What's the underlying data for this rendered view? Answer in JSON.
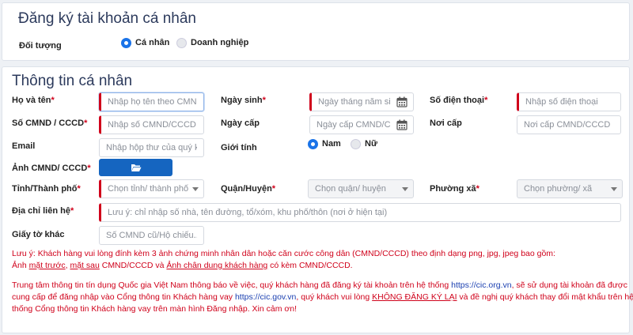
{
  "account_section": {
    "title": "Đăng ký tài khoản cá nhân",
    "type_label": "Đối tượng",
    "options": [
      {
        "label": "Cá nhân",
        "selected": true
      },
      {
        "label": "Doanh nghiệp",
        "selected": false
      }
    ]
  },
  "personal_section": {
    "title": "Thông tin cá nhân",
    "fields": {
      "full_name": {
        "label": "Họ và tên",
        "req": "*",
        "placeholder": "Nhập họ tên theo CMND"
      },
      "birth_date": {
        "label": "Ngày sinh",
        "req": "*",
        "placeholder": "Ngày tháng năm sinh"
      },
      "phone": {
        "label": "Số điện thoại",
        "req": "*",
        "placeholder": "Nhập số điện thoại"
      },
      "id_number": {
        "label": "Số CMND / CCCD",
        "req": "*",
        "placeholder": "Nhập số CMND/CCCD"
      },
      "issue_date": {
        "label": "Ngày cấp",
        "placeholder": "Ngày cấp CMND/CCCD"
      },
      "issue_place": {
        "label": "Nơi cấp",
        "placeholder": "Nơi cấp CMND/CCCD"
      },
      "email": {
        "label": "Email",
        "placeholder": "Nhập hộp thư của quý khách"
      },
      "gender": {
        "label": "Giới tính",
        "options": [
          {
            "label": "Nam",
            "selected": true
          },
          {
            "label": "Nữ",
            "selected": false
          }
        ]
      },
      "id_image": {
        "label": "Ảnh CMND/ CCCD",
        "req": "*"
      },
      "province": {
        "label": "Tỉnh/Thành phố",
        "req": "*",
        "placeholder": "Chọn tỉnh/ thành phố"
      },
      "district": {
        "label": "Quận/Huyện",
        "req": "*",
        "placeholder": "Chọn quận/ huyện"
      },
      "ward": {
        "label": "Phường xã",
        "req": "*",
        "placeholder": "Chọn phường/ xã"
      },
      "address": {
        "label": "Địa chỉ liên hệ",
        "req": "*",
        "placeholder": "Lưu ý: chỉ nhập số nhà, tên đường, tổ/xóm, khu phố/thôn (nơi ở hiện tại)"
      },
      "other_doc": {
        "label": "Giấy tờ khác",
        "placeholder": "Số CMND cũ/Hộ chiếu..."
      }
    },
    "note1": {
      "line1": "Lưu ý: Khách hàng vui lòng đính kèm 3 ảnh chứng minh nhân dân hoặc căn cước công dân (CMND/CCCD) theo định dạng png, jpg, jpeg bao gồm:",
      "l2_a": "Ảnh ",
      "l2_b": "mặt trước",
      "l2_c": ", ",
      "l2_d": "mặt sau",
      "l2_e": " CMND/CCCD và ",
      "l2_f": "Ảnh chân dung khách hàng",
      "l2_g": " có kèm CMND/CCCD."
    },
    "note2": {
      "l1_a": "Trung tâm thông tin tín dụng Quốc gia Việt Nam thông báo về việc, quý khách hàng đã đăng ký tài khoản trên hệ thống ",
      "l1_link": "https://cic.org.vn",
      "l1_b": ", sẽ sử dụng tài khoản đã được",
      "l2_a": "cung cấp để đăng nhập vào Cổng thông tin Khách hàng vay ",
      "l2_link": "https://cic.gov.vn",
      "l2_b": ", quý khách vui lòng ",
      "l2_c": "KHÔNG ĐĂNG KÝ LẠI",
      "l2_d": " và đề nghị quý khách thay đổi mật khẩu trên hệ",
      "l3": "thống Cổng thông tin Khách hàng vay trên màn hình Đăng nhập. Xin cảm ơn!"
    }
  },
  "colors": {
    "accent": "#1a73e8",
    "required": "#d0021b",
    "upload_button": "#1565c0"
  },
  "icons": {
    "date": "calendar-icon",
    "upload": "folder-open-icon",
    "select": "chevron-down-icon"
  }
}
